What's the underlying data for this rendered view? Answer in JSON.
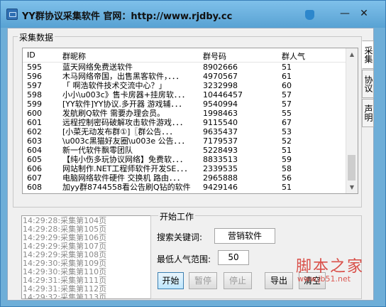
{
  "window": {
    "title": "YY群协议采集软件  官网：http://www.rjdby.cc",
    "min_glyph": "—",
    "close_glyph": "✕"
  },
  "collect": {
    "group_label": "采集数据",
    "columns": {
      "id": "ID",
      "name": "群昵称",
      "number": "群号码",
      "popularity": "群人气"
    },
    "rows": [
      {
        "id": "595",
        "name": "蓝天网络免费送软件",
        "number": "8902666",
        "popularity": "51"
      },
      {
        "id": "596",
        "name": "木马网络帝国，出售黑客软件，．．．",
        "number": "4970567",
        "popularity": "61"
      },
      {
        "id": "597",
        "name": "「 啊浩软件技术交流中心？」",
        "number": "3232998",
        "popularity": "60"
      },
      {
        "id": "598",
        "name": "小小\\u003c》售卡房器+挂房软．．．",
        "number": "10446457",
        "popularity": "57"
      },
      {
        "id": "599",
        "name": "[YY软件]YY协议.多开器 游戏辅．．．",
        "number": "9540994",
        "popularity": "57"
      },
      {
        "id": "600",
        "name": "发航刷Q软件 需要办理会员。",
        "number": "1998463",
        "popularity": "55"
      },
      {
        "id": "601",
        "name": "远程控制密码破解攻击软件游戏．．．",
        "number": "9115540",
        "popularity": "67"
      },
      {
        "id": "602",
        "name": "[小菜无动发布群①]〖群公告．．．",
        "number": "9635437",
        "popularity": "53"
      },
      {
        "id": "603",
        "name": "\\u003c黑猫好友圈\\u003e 公告．．．",
        "number": "7179537",
        "popularity": "52"
      },
      {
        "id": "604",
        "name": "新一代软件飘零团队",
        "number": "5228493",
        "popularity": "51"
      },
      {
        "id": "605",
        "name": "【纯小伤多玩协议网络】免费软．．．",
        "number": "8833513",
        "popularity": "59"
      },
      {
        "id": "606",
        "name": "网站制作.NET工程师软件开发SE．．．",
        "number": "2339535",
        "popularity": "58"
      },
      {
        "id": "607",
        "name": "电脑网络软件硬件 交换机 路由．．．",
        "number": "2965888",
        "popularity": "56"
      },
      {
        "id": "608",
        "name": "加yy群8744558看公告刷Q钻的软件",
        "number": "9429146",
        "popularity": "51"
      }
    ],
    "scroll_up": "▲",
    "scroll_down": "▼"
  },
  "tabs": [
    "采集",
    "协议",
    "声明"
  ],
  "log": [
    "14:29:28:采集第104页",
    "14:29:28:采集第105页",
    "14:29:29:采集第106页",
    "14:29:29:采集第107页",
    "14:29:29:采集第108页",
    "14:29:30:采集第109页",
    "14:29:30:采集第110页",
    "14:29:31:采集第111页",
    "14:29:31:采集第112页",
    "14:29:32:采集第113页"
  ],
  "work": {
    "group_label": "开始工作",
    "keyword_label": "搜索关键词:",
    "keyword_value": "营销软件",
    "min_pop_label": "最低人气范围:",
    "min_pop_value": "50",
    "start": "开始",
    "pause": "暂停",
    "stop": "停止",
    "export": "导出",
    "clear": "清空"
  },
  "watermark": {
    "main": "脚本之家",
    "sub": "www.jb51.net"
  }
}
